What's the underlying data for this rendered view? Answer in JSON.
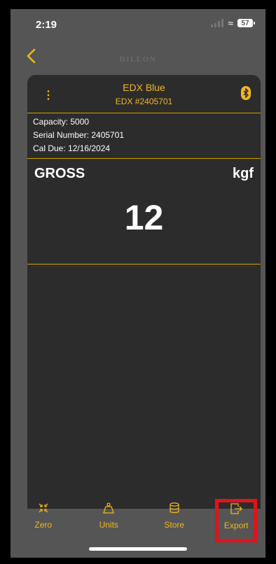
{
  "status_bar": {
    "time": "2:19",
    "battery": "57"
  },
  "nav": {
    "brand": "DILLON",
    "back_icon": "chevron-left-icon"
  },
  "device": {
    "name": "EDX Blue",
    "id": "EDX #2405701",
    "capacity_line": "Capacity: 5000",
    "serial_line": "Serial Number: 2405701",
    "cal_due_line": "Cal Due:  12/16/2024"
  },
  "reading": {
    "mode": "GROSS",
    "unit": "kgf",
    "value": "12"
  },
  "tabs": [
    {
      "label": "Zero",
      "icon": "zero-icon"
    },
    {
      "label": "Units",
      "icon": "weight-icon"
    },
    {
      "label": "Store",
      "icon": "database-icon"
    },
    {
      "label": "Export",
      "icon": "export-icon"
    }
  ],
  "colors": {
    "accent": "#f0b71d",
    "highlight": "#e2131b",
    "card_bg": "#2c2c2c",
    "screen_bg": "#555555"
  }
}
